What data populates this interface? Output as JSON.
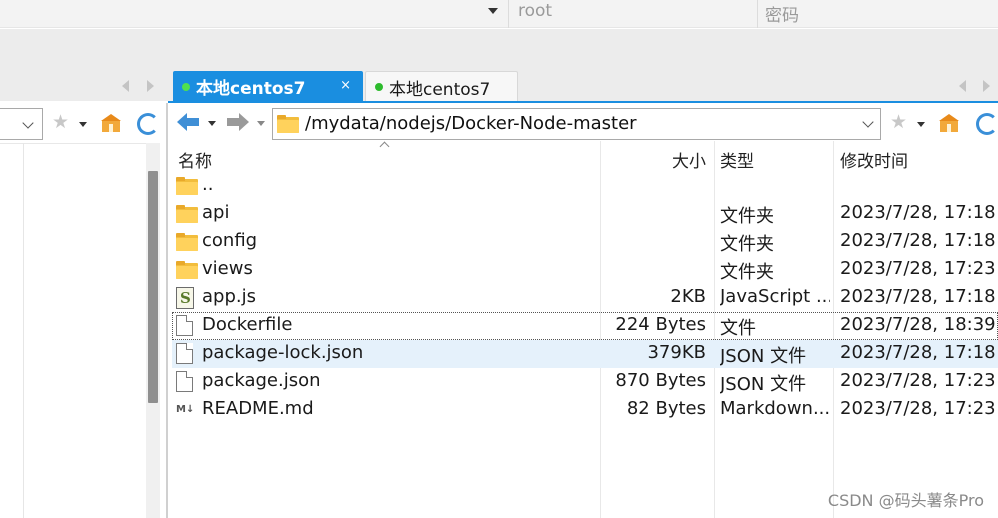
{
  "login": {
    "username": "root",
    "password_placeholder": "密码"
  },
  "tabs": [
    {
      "label": "本地centos7",
      "active": true,
      "status_color": "#4fe04f",
      "close": "×"
    },
    {
      "label": "本地centos7",
      "active": false,
      "status_color": "#2dbb2d"
    }
  ],
  "path": "/mydata/nodejs/Docker-Node-master",
  "columns": {
    "name": "名称",
    "size": "大小",
    "type": "类型",
    "modified": "修改时间"
  },
  "files": [
    {
      "name": "..",
      "size": "",
      "type": "",
      "modified": "",
      "icon": "folder-icon"
    },
    {
      "name": "api",
      "size": "",
      "type": "文件夹",
      "modified": "2023/7/28, 17:18",
      "icon": "folder-icon"
    },
    {
      "name": "config",
      "size": "",
      "type": "文件夹",
      "modified": "2023/7/28, 17:18",
      "icon": "folder-icon"
    },
    {
      "name": "views",
      "size": "",
      "type": "文件夹",
      "modified": "2023/7/28, 17:23",
      "icon": "folder-icon"
    },
    {
      "name": "app.js",
      "size": "2KB",
      "type": "JavaScript ...",
      "modified": "2023/7/28, 17:18",
      "icon": "javascript-file-icon"
    },
    {
      "name": "Dockerfile",
      "size": "224 Bytes",
      "type": "文件",
      "modified": "2023/7/28, 18:39",
      "icon": "file-icon"
    },
    {
      "name": "package-lock.json",
      "size": "379KB",
      "type": "JSON 文件",
      "modified": "2023/7/28, 17:18",
      "icon": "file-icon"
    },
    {
      "name": "package.json",
      "size": "870 Bytes",
      "type": "JSON 文件",
      "modified": "2023/7/28, 17:23",
      "icon": "file-icon"
    },
    {
      "name": "README.md",
      "size": "82 Bytes",
      "type": "Markdown...",
      "modified": "2023/7/28, 17:23",
      "icon": "markdown-file-icon"
    }
  ],
  "watermark": "CSDN @码头薯条Pro",
  "colors": {
    "accent": "#1a8ee0",
    "folder": "#ffd25c",
    "hover_row": "#e5f1fb"
  }
}
